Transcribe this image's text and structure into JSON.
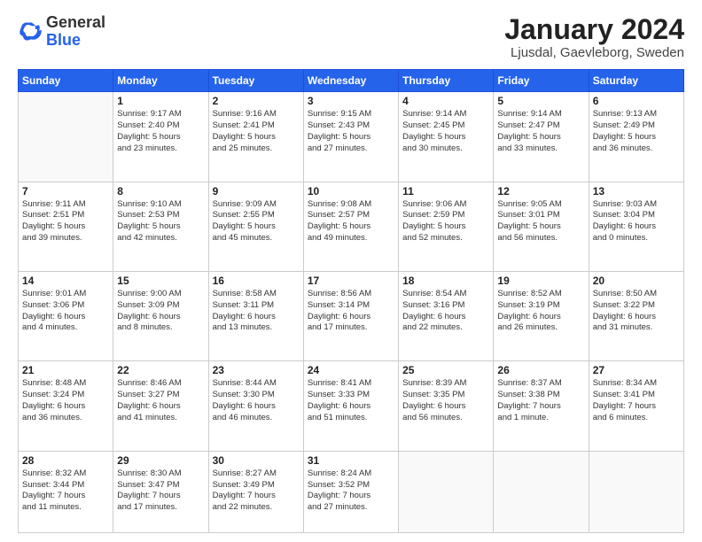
{
  "logo": {
    "general": "General",
    "blue": "Blue"
  },
  "title": "January 2024",
  "location": "Ljusdal, Gaevleborg, Sweden",
  "days_header": [
    "Sunday",
    "Monday",
    "Tuesday",
    "Wednesday",
    "Thursday",
    "Friday",
    "Saturday"
  ],
  "weeks": [
    [
      {
        "day": "",
        "info": ""
      },
      {
        "day": "1",
        "info": "Sunrise: 9:17 AM\nSunset: 2:40 PM\nDaylight: 5 hours\nand 23 minutes."
      },
      {
        "day": "2",
        "info": "Sunrise: 9:16 AM\nSunset: 2:41 PM\nDaylight: 5 hours\nand 25 minutes."
      },
      {
        "day": "3",
        "info": "Sunrise: 9:15 AM\nSunset: 2:43 PM\nDaylight: 5 hours\nand 27 minutes."
      },
      {
        "day": "4",
        "info": "Sunrise: 9:14 AM\nSunset: 2:45 PM\nDaylight: 5 hours\nand 30 minutes."
      },
      {
        "day": "5",
        "info": "Sunrise: 9:14 AM\nSunset: 2:47 PM\nDaylight: 5 hours\nand 33 minutes."
      },
      {
        "day": "6",
        "info": "Sunrise: 9:13 AM\nSunset: 2:49 PM\nDaylight: 5 hours\nand 36 minutes."
      }
    ],
    [
      {
        "day": "7",
        "info": "Sunrise: 9:11 AM\nSunset: 2:51 PM\nDaylight: 5 hours\nand 39 minutes."
      },
      {
        "day": "8",
        "info": "Sunrise: 9:10 AM\nSunset: 2:53 PM\nDaylight: 5 hours\nand 42 minutes."
      },
      {
        "day": "9",
        "info": "Sunrise: 9:09 AM\nSunset: 2:55 PM\nDaylight: 5 hours\nand 45 minutes."
      },
      {
        "day": "10",
        "info": "Sunrise: 9:08 AM\nSunset: 2:57 PM\nDaylight: 5 hours\nand 49 minutes."
      },
      {
        "day": "11",
        "info": "Sunrise: 9:06 AM\nSunset: 2:59 PM\nDaylight: 5 hours\nand 52 minutes."
      },
      {
        "day": "12",
        "info": "Sunrise: 9:05 AM\nSunset: 3:01 PM\nDaylight: 5 hours\nand 56 minutes."
      },
      {
        "day": "13",
        "info": "Sunrise: 9:03 AM\nSunset: 3:04 PM\nDaylight: 6 hours\nand 0 minutes."
      }
    ],
    [
      {
        "day": "14",
        "info": "Sunrise: 9:01 AM\nSunset: 3:06 PM\nDaylight: 6 hours\nand 4 minutes."
      },
      {
        "day": "15",
        "info": "Sunrise: 9:00 AM\nSunset: 3:09 PM\nDaylight: 6 hours\nand 8 minutes."
      },
      {
        "day": "16",
        "info": "Sunrise: 8:58 AM\nSunset: 3:11 PM\nDaylight: 6 hours\nand 13 minutes."
      },
      {
        "day": "17",
        "info": "Sunrise: 8:56 AM\nSunset: 3:14 PM\nDaylight: 6 hours\nand 17 minutes."
      },
      {
        "day": "18",
        "info": "Sunrise: 8:54 AM\nSunset: 3:16 PM\nDaylight: 6 hours\nand 22 minutes."
      },
      {
        "day": "19",
        "info": "Sunrise: 8:52 AM\nSunset: 3:19 PM\nDaylight: 6 hours\nand 26 minutes."
      },
      {
        "day": "20",
        "info": "Sunrise: 8:50 AM\nSunset: 3:22 PM\nDaylight: 6 hours\nand 31 minutes."
      }
    ],
    [
      {
        "day": "21",
        "info": "Sunrise: 8:48 AM\nSunset: 3:24 PM\nDaylight: 6 hours\nand 36 minutes."
      },
      {
        "day": "22",
        "info": "Sunrise: 8:46 AM\nSunset: 3:27 PM\nDaylight: 6 hours\nand 41 minutes."
      },
      {
        "day": "23",
        "info": "Sunrise: 8:44 AM\nSunset: 3:30 PM\nDaylight: 6 hours\nand 46 minutes."
      },
      {
        "day": "24",
        "info": "Sunrise: 8:41 AM\nSunset: 3:33 PM\nDaylight: 6 hours\nand 51 minutes."
      },
      {
        "day": "25",
        "info": "Sunrise: 8:39 AM\nSunset: 3:35 PM\nDaylight: 6 hours\nand 56 minutes."
      },
      {
        "day": "26",
        "info": "Sunrise: 8:37 AM\nSunset: 3:38 PM\nDaylight: 7 hours\nand 1 minute."
      },
      {
        "day": "27",
        "info": "Sunrise: 8:34 AM\nSunset: 3:41 PM\nDaylight: 7 hours\nand 6 minutes."
      }
    ],
    [
      {
        "day": "28",
        "info": "Sunrise: 8:32 AM\nSunset: 3:44 PM\nDaylight: 7 hours\nand 11 minutes."
      },
      {
        "day": "29",
        "info": "Sunrise: 8:30 AM\nSunset: 3:47 PM\nDaylight: 7 hours\nand 17 minutes."
      },
      {
        "day": "30",
        "info": "Sunrise: 8:27 AM\nSunset: 3:49 PM\nDaylight: 7 hours\nand 22 minutes."
      },
      {
        "day": "31",
        "info": "Sunrise: 8:24 AM\nSunset: 3:52 PM\nDaylight: 7 hours\nand 27 minutes."
      },
      {
        "day": "",
        "info": ""
      },
      {
        "day": "",
        "info": ""
      },
      {
        "day": "",
        "info": ""
      }
    ]
  ]
}
